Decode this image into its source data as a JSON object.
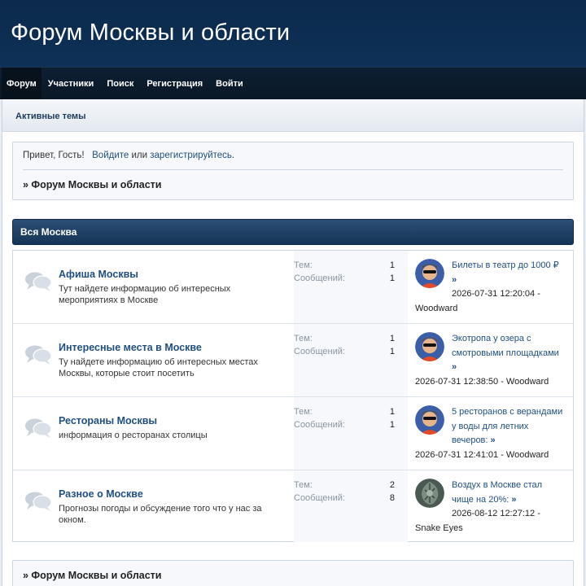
{
  "site": {
    "title": "Форум Москвы и области"
  },
  "nav": [
    {
      "label": "Форум",
      "active": true
    },
    {
      "label": "Участники"
    },
    {
      "label": "Поиск"
    },
    {
      "label": "Регистрация"
    },
    {
      "label": "Войти"
    }
  ],
  "subnav": {
    "active_topics": "Активные темы"
  },
  "welcome": {
    "greeting": "Привет, Гость!",
    "login": "Войдите",
    "or": "или",
    "register": "зарегистрируйтесь",
    "period": ".",
    "crumb": "» Форум Москвы и области"
  },
  "category": {
    "title": "Вся Москва"
  },
  "labels": {
    "topics": "Тем:",
    "posts": "Сообщений:"
  },
  "forums": [
    {
      "name": "Афиша Москвы",
      "desc": "Тут найдете информацию об интересных мероприятиях в Москве",
      "topics": "1",
      "posts": "1",
      "last_title": "Билеты в театр до 1000 ₽",
      "last_arrow": "»",
      "last_meta": "2026-07-31 12:20:04 - Woodward"
    },
    {
      "name": "Интересные места в Москве",
      "desc": "Ту найдете информацию об интересных местах Москвы, которые стоит посетить",
      "topics": "1",
      "posts": "1",
      "last_title": "Экотропа у озера с смотровыми площадками",
      "last_arrow": "»",
      "last_meta": "2026-07-31 12:38:50 - Woodward"
    },
    {
      "name": "Рестораны Москвы",
      "desc": "информация о ресторанах столицы",
      "topics": "1",
      "posts": "1",
      "last_title": "5 ресторанов с верандами у воды для летних вечеров:",
      "last_arrow": "»",
      "last_meta": "2026-07-31 12:41:01 - Woodward"
    },
    {
      "name": "Разное о Москве",
      "desc": "Прогнозы погоды и обсуждение того что у нас за окном.",
      "topics": "2",
      "posts": "8",
      "last_title": "Воздух в Москве стал чище на 20%:",
      "last_arrow": "»",
      "last_meta": "2026-08-12 12:27:12 - Snake Eyes"
    }
  ],
  "footer": {
    "crumb": "» Форум Москвы и области"
  },
  "colors": {
    "header": "#0e3157",
    "nav": "#0a1826",
    "link": "#1f4f82"
  }
}
